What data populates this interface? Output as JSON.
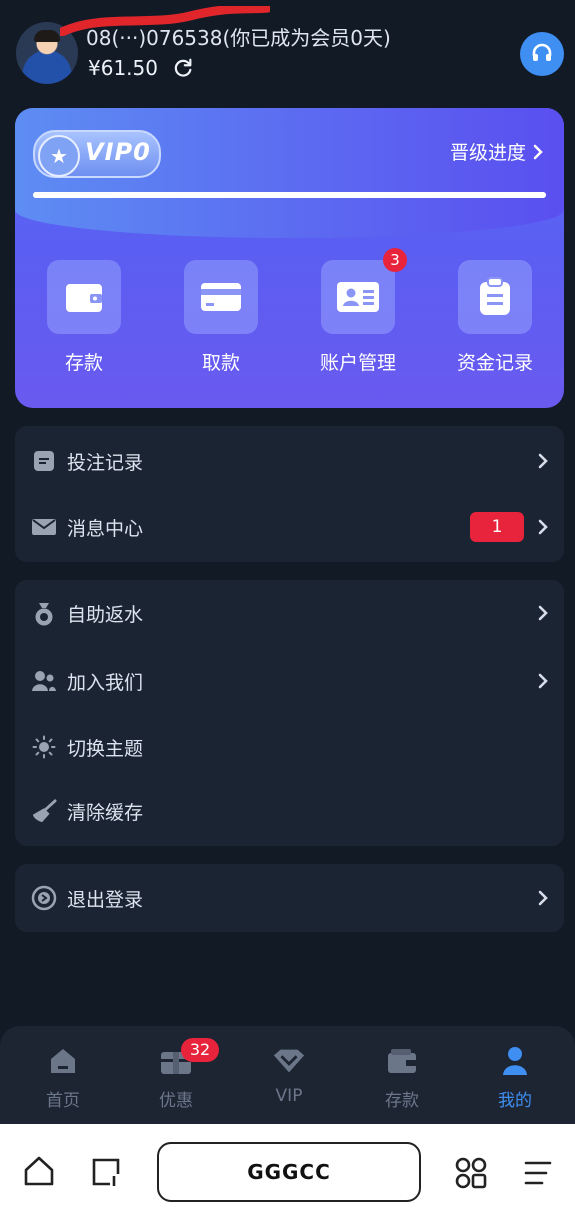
{
  "header": {
    "username_masked": "08(···)076538",
    "member_note": "(你已成为会员0天)",
    "balance": "¥61.50"
  },
  "vip": {
    "level": "VIP0",
    "progress_link": "晋级进度",
    "progress_fraction": 1.0
  },
  "actions": [
    {
      "label": "存款",
      "icon": "wallet-icon"
    },
    {
      "label": "取款",
      "icon": "card-icon"
    },
    {
      "label": "账户管理",
      "icon": "id-card-icon",
      "badge": "3"
    },
    {
      "label": "资金记录",
      "icon": "clipboard-icon"
    }
  ],
  "menu_group_1": [
    {
      "label": "投注记录",
      "icon": "document-icon"
    },
    {
      "label": "消息中心",
      "icon": "envelope-icon",
      "badge": "1"
    }
  ],
  "menu_group_2": [
    {
      "label": "自助返水",
      "icon": "money-bag-icon"
    },
    {
      "label": "加入我们",
      "icon": "users-icon"
    },
    {
      "label": "切换主题",
      "icon": "sun-icon"
    },
    {
      "label": "清除缓存",
      "icon": "broom-icon"
    }
  ],
  "logout": {
    "label": "退出登录",
    "icon": "logout-icon"
  },
  "tabs": [
    {
      "label": "首页",
      "icon": "home-icon"
    },
    {
      "label": "优惠",
      "icon": "gift-icon",
      "badge": "32"
    },
    {
      "label": "VIP",
      "icon": "diamond-icon"
    },
    {
      "label": "存款",
      "icon": "wallet-icon"
    },
    {
      "label": "我的",
      "icon": "user-icon",
      "active": true
    }
  ],
  "browser": {
    "url_text": "GGGCC"
  },
  "colors": {
    "accent": "#3f8ef2",
    "badge": "#e8243c",
    "panel": "#1b2432",
    "background": "#121a26"
  }
}
